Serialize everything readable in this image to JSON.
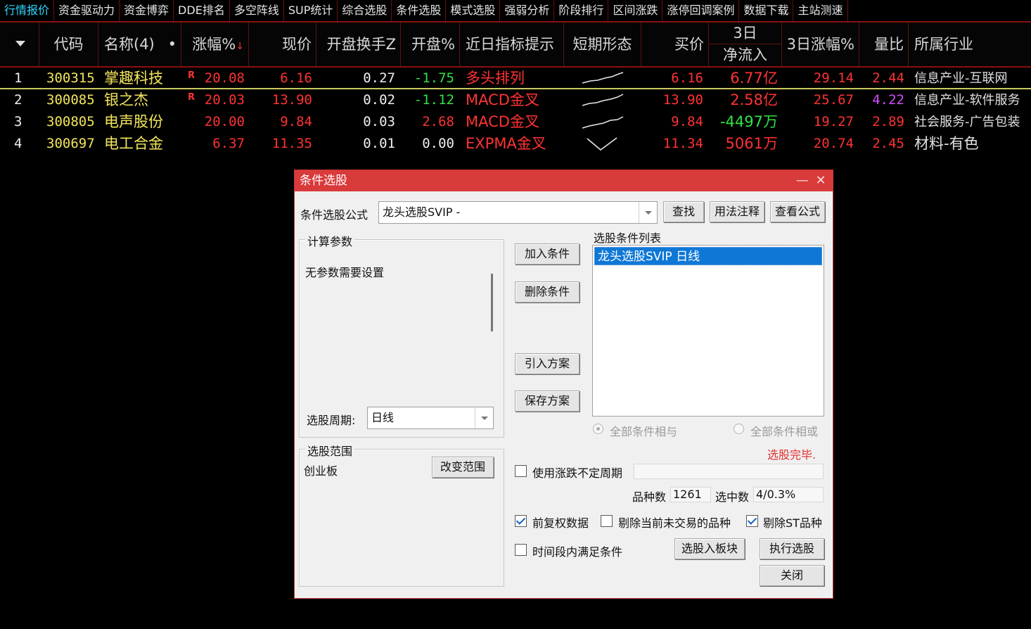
{
  "menu": [
    "行情报价",
    "资金驱动力",
    "资金博弈",
    "DDE排名",
    "多空阵线",
    "SUP统计",
    "综合选股",
    "条件选股",
    "模式选股",
    "强弱分析",
    "阶段排行",
    "区间涨跌",
    "涨停回调案例",
    "数据下载",
    "主站测速"
  ],
  "table": {
    "headers": {
      "code": "代码",
      "name": "名称(4)",
      "name_dot": "•",
      "change_pct": "涨幅%",
      "sort_arrow": "↓",
      "price": "现价",
      "open_turnover": "开盘换手Z",
      "open_pct": "开盘%",
      "indicator": "近日指标提示",
      "pattern": "短期形态",
      "bid": "买价",
      "netflow_top": "3日",
      "netflow_bottom": "净流入",
      "change3d": "3日涨幅%",
      "vol_ratio": "量比",
      "industry": "所属行业"
    },
    "rows": [
      {
        "idx": "1",
        "code": "300315",
        "name": "掌趣科技",
        "badge": "R",
        "change": "20.08",
        "price": "6.16",
        "turnover": "0.27",
        "open_pct": "-1.75",
        "indicator": "多头排列",
        "bid": "6.16",
        "netflow": "6.77亿",
        "change3d": "29.14",
        "vol_ratio": "2.44",
        "industry": "信息产业-互联网"
      },
      {
        "idx": "2",
        "code": "300085",
        "name": "银之杰",
        "badge": "R",
        "change": "20.03",
        "price": "13.90",
        "turnover": "0.02",
        "open_pct": "-1.12",
        "indicator": "MACD金叉",
        "bid": "13.90",
        "netflow": "2.58亿",
        "change3d": "25.67",
        "vol_ratio": "4.22",
        "industry": "信息产业-软件服务"
      },
      {
        "idx": "3",
        "code": "300805",
        "name": "电声股份",
        "badge": "",
        "change": "20.00",
        "price": "9.84",
        "turnover": "0.03",
        "open_pct": "2.68",
        "indicator": "MACD金叉",
        "bid": "9.84",
        "netflow": "-4497万",
        "change3d": "19.27",
        "vol_ratio": "2.89",
        "industry": "社会服务-广告包装"
      },
      {
        "idx": "4",
        "code": "300697",
        "name": "电工合金",
        "badge": "",
        "change": "6.37",
        "price": "11.35",
        "turnover": "0.01",
        "open_pct": "0.00",
        "indicator": "EXPMA金叉",
        "bid": "11.34",
        "netflow": "5061万",
        "change3d": "20.74",
        "vol_ratio": "2.45",
        "industry": "材料-有色"
      }
    ]
  },
  "dialog": {
    "title": "条件选股",
    "minimize": "—",
    "close": "✕",
    "formula_label": "条件选股公式",
    "formula_value": "龙头选股SVIP -",
    "find": "查找",
    "usage": "用法注释",
    "view_formula": "查看公式",
    "params_group": "计算参数",
    "params_text": "无参数需要设置",
    "period_label": "选股周期:",
    "period_value": "日线",
    "add_condition": "加入条件",
    "delete_condition": "删除条件",
    "import_plan": "引入方案",
    "save_plan": "保存方案",
    "list_label": "选股条件列表",
    "list_items": [
      "龙头选股SVIP  日线"
    ],
    "radio_and": "全部条件相与",
    "radio_or": "全部条件相或",
    "status": "选股完毕.",
    "range_group": "选股范围",
    "range_value": "创业板",
    "change_range": "改变范围",
    "use_variable_period": "使用涨跌不定周期",
    "count_label": "品种数",
    "count_value": "1261",
    "selected_label": "选中数",
    "selected_value": "4/0.3%",
    "adjusted": "前复权数据",
    "exclude_untraded": "剔除当前未交易的品种",
    "exclude_st": "剔除ST品种",
    "period_satisfy": "时间段内满足条件",
    "to_block": "选股入板块",
    "execute": "执行选股",
    "close_btn": "关闭"
  },
  "colors": {
    "accent_red": "#d93a3a",
    "up": "#ff3232",
    "down": "#33e045",
    "code": "#f3e65a",
    "selection": "#0f78d7"
  }
}
